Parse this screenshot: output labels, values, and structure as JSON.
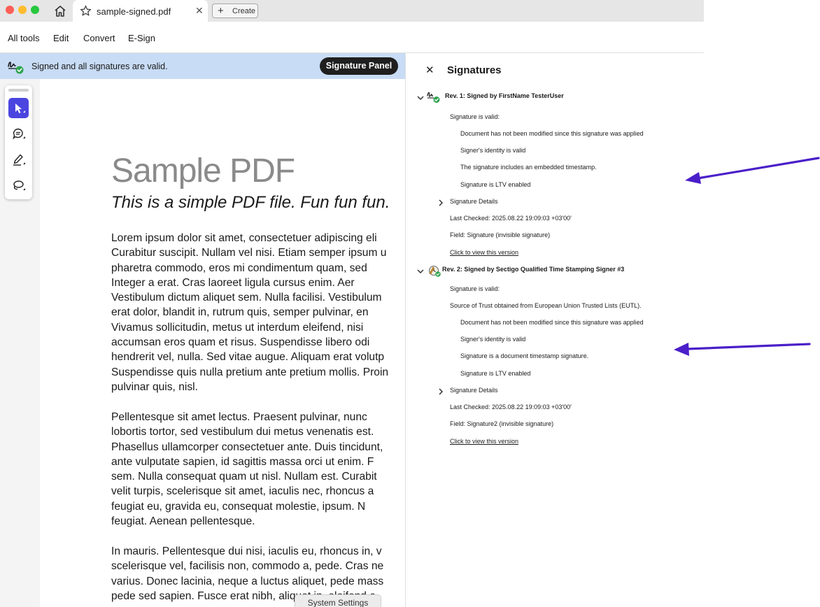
{
  "tab": {
    "title": "sample-signed.pdf",
    "create_label": "Create"
  },
  "menu": {
    "items": [
      "All tools",
      "Edit",
      "Convert",
      "E-Sign"
    ]
  },
  "banner": {
    "text": "Signed and all signatures are valid.",
    "button": "Signature Panel"
  },
  "document": {
    "title": "Sample PDF",
    "subtitle": "This is a simple PDF file. Fun fun fun.",
    "paragraphs": [
      [
        "Lorem ipsum dolor sit amet, consectetuer adipiscing eli",
        "Curabitur suscipit. Nullam vel nisi. Etiam semper ipsum u",
        "pharetra commodo, eros mi condimentum quam, sed",
        "Integer a erat. Cras laoreet ligula cursus enim. Aer",
        "Vestibulum dictum aliquet sem. Nulla facilisi. Vestibulum",
        "erat dolor, blandit in, rutrum quis, semper pulvinar, en",
        "Vivamus sollicitudin, metus ut interdum eleifend, nisi",
        "accumsan eros quam et risus. Suspendisse libero odi",
        "hendrerit vel, nulla. Sed vitae augue. Aliquam erat volutp",
        "Suspendisse quis nulla pretium ante pretium mollis. Proin",
        "pulvinar quis, nisl."
      ],
      [
        "Pellentesque sit amet lectus. Praesent pulvinar, nunc",
        "lobortis tortor, sed vestibulum dui metus venenatis est.",
        "Phasellus ullamcorper consectetuer ante. Duis tincidunt,",
        "ante vulputate sapien, id sagittis massa orci ut enim. F",
        "sem. Nulla consequat quam ut nisl. Nullam est. Curabit",
        "velit turpis, scelerisque sit amet, iaculis nec, rhoncus a",
        "feugiat eu, gravida eu, consequat molestie, ipsum. N",
        "feugiat. Aenean pellentesque."
      ],
      [
        "In mauris. Pellentesque dui nisi, iaculis eu, rhoncus in, v",
        "scelerisque vel, facilisis non, commodo a, pede. Cras ne",
        "varius. Donec lacinia, neque a luctus aliquet, pede mass",
        "pede sed sapien. Fusce erat nibh, aliquet in, eleifend e"
      ]
    ]
  },
  "tooltip": {
    "text": "System Settings"
  },
  "signatures": {
    "heading": "Signatures",
    "revisions": [
      {
        "title": "Rev. 1: Signed by FirstName TesterUser",
        "icon": "signature-valid-icon",
        "valid": "Signature is valid:",
        "source": "",
        "details": [
          "Document has not been modified since this signature was applied",
          "Signer's identity is valid",
          "The signature includes an embedded timestamp.",
          "Signature is LTV enabled"
        ],
        "details_label": "Signature Details",
        "last_checked": "Last Checked: 2025.08.22 19:09:03 +03'00'",
        "field": "Field: Signature (invisible signature)",
        "view_link": "Click to view this version"
      },
      {
        "title": "Rev. 2: Signed by Sectigo Qualified Time Stamping Signer #3",
        "icon": "timestamp-signature-icon",
        "valid": "Signature is valid:",
        "source": "Source of Trust obtained from European Union Trusted Lists (EUTL).",
        "details": [
          "Document has not been modified since this signature was applied",
          "Signer's identity is valid",
          "Signature is a document timestamp signature.",
          "Signature is LTV enabled"
        ],
        "details_label": "Signature Details",
        "last_checked": "Last Checked: 2025.08.22 19:09:03 +03'00'",
        "field": "Field: Signature2 (invisible signature)",
        "view_link": "Click to view this version"
      }
    ]
  },
  "colors": {
    "banner_bg": "#c8dcf5",
    "accent": "#4b45e0",
    "arrow": "#4b1fc9",
    "valid_green": "#2da44e"
  }
}
